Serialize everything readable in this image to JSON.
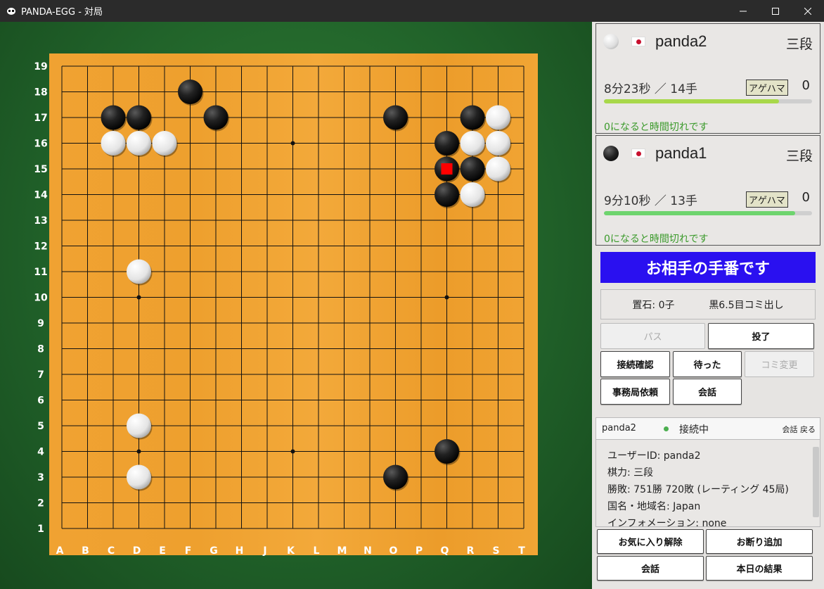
{
  "window": {
    "title": "PANDA-EGG - 対局",
    "minimize": "—",
    "maximize": "☐",
    "close": "✕"
  },
  "board": {
    "size": 19,
    "col_labels": [
      "A",
      "B",
      "C",
      "D",
      "E",
      "F",
      "G",
      "H",
      "J",
      "K",
      "L",
      "M",
      "N",
      "O",
      "P",
      "Q",
      "R",
      "S",
      "T"
    ],
    "row_labels": [
      "19",
      "18",
      "17",
      "16",
      "15",
      "14",
      "13",
      "12",
      "11",
      "10",
      "9",
      "8",
      "7",
      "6",
      "5",
      "4",
      "3",
      "2",
      "1"
    ],
    "star_points": [
      [
        4,
        4
      ],
      [
        4,
        10
      ],
      [
        4,
        16
      ],
      [
        10,
        4
      ],
      [
        10,
        16
      ],
      [
        16,
        4
      ],
      [
        16,
        10
      ],
      [
        16,
        16
      ]
    ],
    "stones": [
      {
        "col": "F",
        "row": 18,
        "color": "black"
      },
      {
        "col": "C",
        "row": 17,
        "color": "black"
      },
      {
        "col": "D",
        "row": 17,
        "color": "black"
      },
      {
        "col": "G",
        "row": 17,
        "color": "black"
      },
      {
        "col": "O",
        "row": 17,
        "color": "black"
      },
      {
        "col": "R",
        "row": 17,
        "color": "black"
      },
      {
        "col": "S",
        "row": 17,
        "color": "white"
      },
      {
        "col": "C",
        "row": 16,
        "color": "white"
      },
      {
        "col": "D",
        "row": 16,
        "color": "white"
      },
      {
        "col": "E",
        "row": 16,
        "color": "white"
      },
      {
        "col": "Q",
        "row": 16,
        "color": "black"
      },
      {
        "col": "R",
        "row": 16,
        "color": "white"
      },
      {
        "col": "S",
        "row": 16,
        "color": "white"
      },
      {
        "col": "Q",
        "row": 15,
        "color": "black",
        "last_move": true
      },
      {
        "col": "R",
        "row": 15,
        "color": "black"
      },
      {
        "col": "S",
        "row": 15,
        "color": "white"
      },
      {
        "col": "Q",
        "row": 14,
        "color": "black"
      },
      {
        "col": "R",
        "row": 14,
        "color": "white"
      },
      {
        "col": "D",
        "row": 11,
        "color": "white"
      },
      {
        "col": "D",
        "row": 5,
        "color": "white"
      },
      {
        "col": "Q",
        "row": 4,
        "color": "black"
      },
      {
        "col": "D",
        "row": 3,
        "color": "white"
      },
      {
        "col": "O",
        "row": 3,
        "color": "black"
      }
    ],
    "last_move_marker_color": "#ff0000"
  },
  "players": [
    {
      "stone": "white",
      "name": "panda2",
      "rank": "三段",
      "time": "8分23秒 ／ 14手",
      "agehama_label": "アゲハマ",
      "agehama": "0",
      "time_fraction": 0.84,
      "bar_color": "#a8d84a",
      "warning": "0になると時間切れです"
    },
    {
      "stone": "black",
      "name": "panda1",
      "rank": "三段",
      "time": "9分10秒 ／ 13手",
      "agehama_label": "アゲハマ",
      "agehama": "0",
      "time_fraction": 0.92,
      "bar_color": "#6ed46e",
      "warning": "0になると時間切れです"
    }
  ],
  "status": {
    "turn_message": "お相手の手番です",
    "handicap": "置石: 0子",
    "komi": "黒6.5目コミ出し"
  },
  "buttons": {
    "pass": "パス",
    "resign": "投了",
    "connection_check": "接続確認",
    "undo": "待った",
    "komi_change": "コミ変更",
    "office_request": "事務局依頼",
    "chat": "会話"
  },
  "chat": {
    "user": "panda2",
    "status": "接続中",
    "links": "会話 戻る"
  },
  "profile": {
    "lines": [
      "ユーザーID: panda2",
      "棋力: 三段",
      "勝敗: 751勝 720敗 (レーティング 45局)",
      "国名・地域名: Japan",
      "インフォメーション: none"
    ]
  },
  "bottom_buttons": {
    "unfavorite": "お気に入り解除",
    "block": "お断り追加",
    "chat": "会話",
    "today": "本日の結果"
  },
  "colors": {
    "turn_bg": "#2a10f0",
    "board_wood": "#f0a030"
  }
}
